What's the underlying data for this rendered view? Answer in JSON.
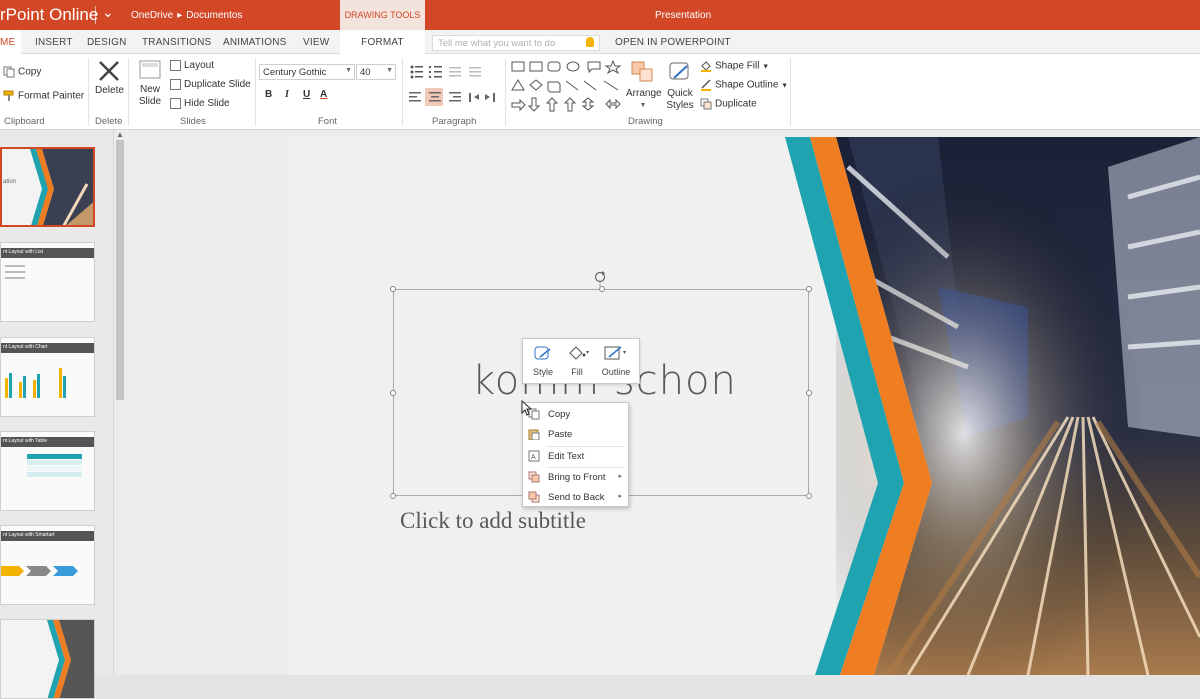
{
  "titlebar": {
    "app_name": "rPoint Online",
    "breadcrumb_root": "OneDrive",
    "breadcrumb_sep": "▸",
    "breadcrumb_folder": "Documentos",
    "presentation_name": "Presentation",
    "contextual_tools": "DRAWING TOOLS"
  },
  "tabs": {
    "home": "ME",
    "insert": "INSERT",
    "design": "DESIGN",
    "transitions": "TRANSITIONS",
    "animations": "ANIMATIONS",
    "view": "VIEW",
    "format": "FORMAT",
    "tell_me_placeholder": "Tell me what you want to do",
    "open_in_app": "OPEN IN POWERPOINT"
  },
  "ribbon": {
    "clipboard": {
      "copy": "Copy",
      "format_painter": "Format Painter",
      "group": "Clipboard"
    },
    "delete": {
      "delete": "Delete",
      "group": "Delete"
    },
    "slides": {
      "new_slide_1": "New",
      "new_slide_2": "Slide",
      "layout": "Layout",
      "duplicate_slide": "Duplicate Slide",
      "hide_slide": "Hide Slide",
      "group": "Slides"
    },
    "font": {
      "family": "Century Gothic",
      "size": "40",
      "bold": "B",
      "italic": "I",
      "underline": "U",
      "font_color": "A",
      "group": "Font"
    },
    "paragraph": {
      "group": "Paragraph"
    },
    "drawing": {
      "arrange": "Arrange",
      "quick_1": "Quick",
      "quick_2": "Styles",
      "shape_fill": "Shape Fill",
      "shape_outline": "Shape Outline",
      "duplicate": "Duplicate",
      "group": "Drawing"
    }
  },
  "slide": {
    "title": "komm schon",
    "subtitle_placeholder": "Click to add subtitle"
  },
  "mini_toolbar": {
    "style": "Style",
    "fill": "Fill",
    "outline": "Outline"
  },
  "context_menu": {
    "copy": "Copy",
    "paste": "Paste",
    "edit_text": "Edit Text",
    "bring_to_front": "Bring to Front",
    "send_to_back": "Send to Back"
  },
  "thumbnails": {
    "t1_title": "ation",
    "t2_header": "nt Layout with List",
    "t3_header": "nt Layout with Chart",
    "t4_header": "nt Layout with Table",
    "t5_header": "nt Layout with Smartart"
  },
  "colors": {
    "accent": "#d24726",
    "teal": "#1fa3b0",
    "orange": "#ef7d22"
  }
}
